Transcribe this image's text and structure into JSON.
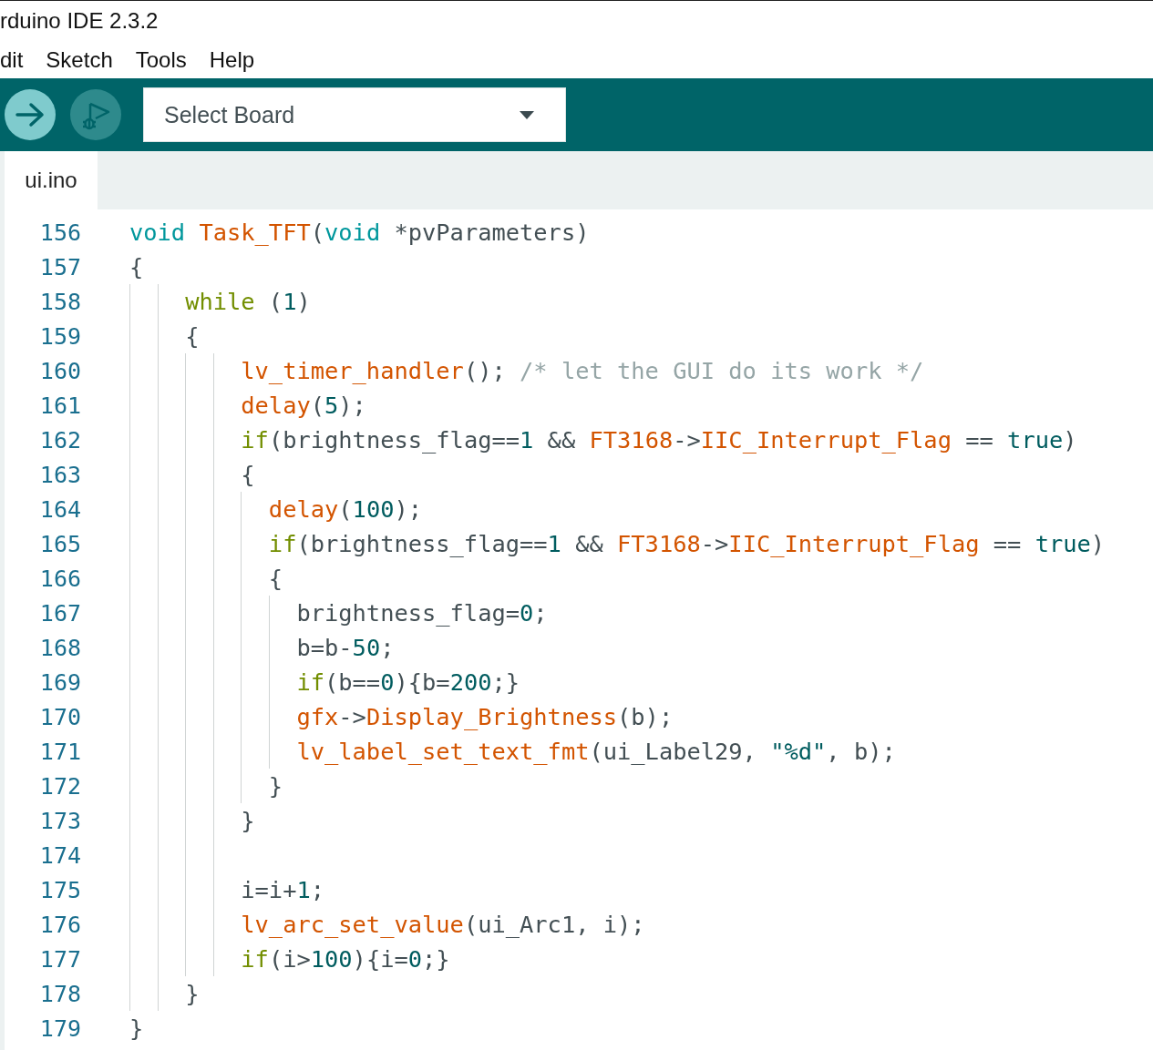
{
  "window": {
    "title": "rduino IDE 2.3.2"
  },
  "menu": [
    {
      "label": "dit"
    },
    {
      "label": "Sketch"
    },
    {
      "label": "Tools"
    },
    {
      "label": "Help"
    }
  ],
  "toolbar": {
    "buttons": [
      {
        "kind": "upload",
        "disabled": false
      },
      {
        "kind": "debug",
        "disabled": true
      }
    ],
    "board_select": {
      "value": "Select Board"
    }
  },
  "tabs": [
    {
      "label": "ui.ino",
      "selected": true
    }
  ],
  "editor": {
    "lines": [
      {
        "number": "156",
        "tokens": [
          {
            "text": "void ",
            "kind": "type"
          },
          {
            "text": "Task_TFT",
            "kind": "function"
          },
          {
            "text": "(",
            "kind": "plain"
          },
          {
            "text": "void",
            "kind": "type"
          },
          {
            "text": " *pvParameters)",
            "kind": "plain"
          }
        ]
      },
      {
        "number": "157",
        "tokens": [
          {
            "text": "{",
            "kind": "plain"
          }
        ]
      },
      {
        "number": "158",
        "tokens": [
          {
            "text": "    while",
            "kind": "control"
          },
          {
            "text": " (",
            "kind": "plain"
          },
          {
            "text": "1",
            "kind": "literal"
          },
          {
            "text": ")",
            "kind": "plain"
          }
        ]
      },
      {
        "number": "159",
        "tokens": [
          {
            "text": "    {",
            "kind": "plain"
          }
        ]
      },
      {
        "number": "160",
        "tokens": [
          {
            "text": "        lv_timer_handler",
            "kind": "function"
          },
          {
            "text": "(); ",
            "kind": "plain"
          },
          {
            "text": "/* let the GUI do its work */",
            "kind": "comment"
          }
        ]
      },
      {
        "number": "161",
        "tokens": [
          {
            "text": "        delay",
            "kind": "function"
          },
          {
            "text": "(",
            "kind": "plain"
          },
          {
            "text": "5",
            "kind": "literal"
          },
          {
            "text": ");",
            "kind": "plain"
          }
        ]
      },
      {
        "number": "162",
        "tokens": [
          {
            "text": "        if",
            "kind": "control"
          },
          {
            "text": "(brightness_flag==",
            "kind": "plain"
          },
          {
            "text": "1",
            "kind": "literal"
          },
          {
            "text": " && ",
            "kind": "plain"
          },
          {
            "text": "FT3168",
            "kind": "function"
          },
          {
            "text": "->",
            "kind": "plain"
          },
          {
            "text": "IIC_Interrupt_Flag",
            "kind": "function"
          },
          {
            "text": " == ",
            "kind": "plain"
          },
          {
            "text": "true",
            "kind": "literal"
          },
          {
            "text": ")",
            "kind": "plain"
          }
        ]
      },
      {
        "number": "163",
        "tokens": [
          {
            "text": "        {",
            "kind": "plain"
          }
        ]
      },
      {
        "number": "164",
        "tokens": [
          {
            "text": "          delay",
            "kind": "function"
          },
          {
            "text": "(",
            "kind": "plain"
          },
          {
            "text": "100",
            "kind": "literal"
          },
          {
            "text": ");",
            "kind": "plain"
          }
        ]
      },
      {
        "number": "165",
        "tokens": [
          {
            "text": "          if",
            "kind": "control"
          },
          {
            "text": "(brightness_flag==",
            "kind": "plain"
          },
          {
            "text": "1",
            "kind": "literal"
          },
          {
            "text": " && ",
            "kind": "plain"
          },
          {
            "text": "FT3168",
            "kind": "function"
          },
          {
            "text": "->",
            "kind": "plain"
          },
          {
            "text": "IIC_Interrupt_Flag",
            "kind": "function"
          },
          {
            "text": " == ",
            "kind": "plain"
          },
          {
            "text": "true",
            "kind": "literal"
          },
          {
            "text": ")",
            "kind": "plain"
          }
        ]
      },
      {
        "number": "166",
        "tokens": [
          {
            "text": "          {",
            "kind": "plain"
          }
        ]
      },
      {
        "number": "167",
        "tokens": [
          {
            "text": "            brightness_flag=",
            "kind": "plain"
          },
          {
            "text": "0",
            "kind": "literal"
          },
          {
            "text": ";",
            "kind": "plain"
          }
        ]
      },
      {
        "number": "168",
        "tokens": [
          {
            "text": "            b=b-",
            "kind": "plain"
          },
          {
            "text": "50",
            "kind": "literal"
          },
          {
            "text": ";",
            "kind": "plain"
          }
        ]
      },
      {
        "number": "169",
        "tokens": [
          {
            "text": "            if",
            "kind": "control"
          },
          {
            "text": "(b==",
            "kind": "plain"
          },
          {
            "text": "0",
            "kind": "literal"
          },
          {
            "text": "){b=",
            "kind": "plain"
          },
          {
            "text": "200",
            "kind": "literal"
          },
          {
            "text": ";}",
            "kind": "plain"
          }
        ]
      },
      {
        "number": "170",
        "tokens": [
          {
            "text": "            gfx",
            "kind": "function"
          },
          {
            "text": "->",
            "kind": "plain"
          },
          {
            "text": "Display_Brightness",
            "kind": "function"
          },
          {
            "text": "(b);",
            "kind": "plain"
          }
        ]
      },
      {
        "number": "171",
        "tokens": [
          {
            "text": "            lv_label_set_text_fmt",
            "kind": "function"
          },
          {
            "text": "(ui_Label29, ",
            "kind": "plain"
          },
          {
            "text": "\"%d\"",
            "kind": "string"
          },
          {
            "text": ", b);",
            "kind": "plain"
          }
        ]
      },
      {
        "number": "172",
        "tokens": [
          {
            "text": "          }",
            "kind": "plain"
          }
        ]
      },
      {
        "number": "173",
        "tokens": [
          {
            "text": "        }",
            "kind": "plain"
          }
        ]
      },
      {
        "number": "174"
      },
      {
        "number": "175",
        "tokens": [
          {
            "text": "        i=i+",
            "kind": "plain"
          },
          {
            "text": "1",
            "kind": "literal"
          },
          {
            "text": ";",
            "kind": "plain"
          }
        ]
      },
      {
        "number": "176",
        "tokens": [
          {
            "text": "        lv_arc_set_value",
            "kind": "function"
          },
          {
            "text": "(ui_Arc1, i);",
            "kind": "plain"
          }
        ]
      },
      {
        "number": "177",
        "tokens": [
          {
            "text": "        if",
            "kind": "control"
          },
          {
            "text": "(i>",
            "kind": "plain"
          },
          {
            "text": "100",
            "kind": "literal"
          },
          {
            "text": "){i=",
            "kind": "plain"
          },
          {
            "text": "0",
            "kind": "literal"
          },
          {
            "text": ";}",
            "kind": "plain"
          }
        ]
      },
      {
        "number": "178",
        "tokens": [
          {
            "text": "    }",
            "kind": "plain"
          }
        ]
      },
      {
        "number": "179",
        "tokens": [
          {
            "text": "}",
            "kind": "plain"
          }
        ]
      }
    ]
  }
}
